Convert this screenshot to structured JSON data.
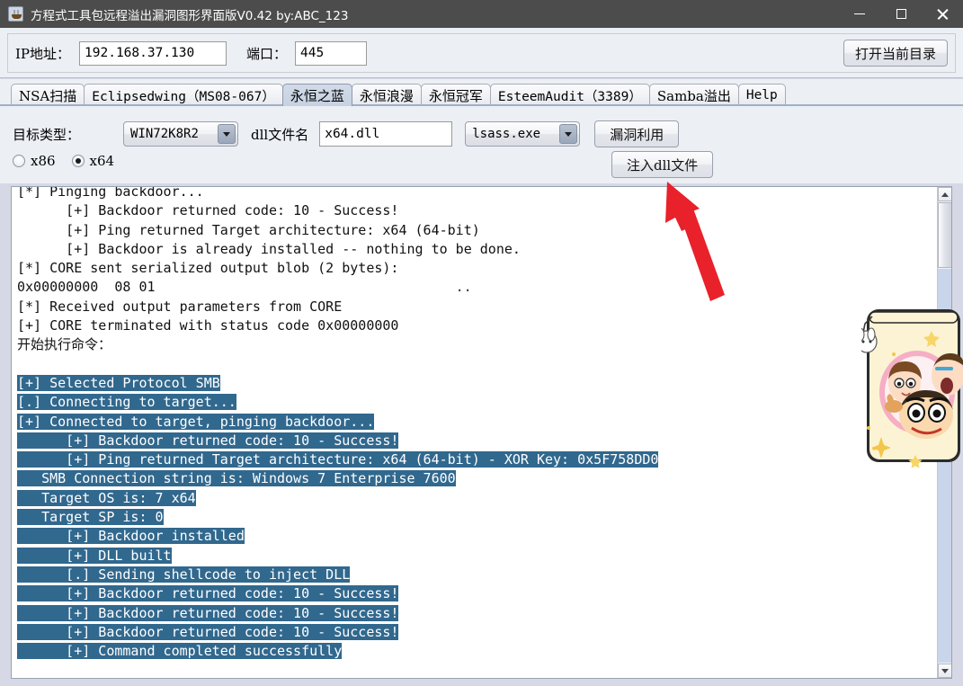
{
  "window": {
    "title": "方程式工具包远程溢出漏洞图形界面版V0.42 by:ABC_123",
    "app_icon": "java-coffee-cup-icon",
    "minimize_label": "最小化",
    "maximize_label": "最大化",
    "close_label": "关闭"
  },
  "toolbar": {
    "ip_label": "IP地址：",
    "ip_value": "192.168.37.130",
    "ip_placeholder": "",
    "port_label": "端口：",
    "port_value": "445",
    "port_placeholder": "",
    "open_dir_label": "打开当前目录"
  },
  "tabs": [
    {
      "label": "NSA扫描",
      "active": false,
      "cjk": true
    },
    {
      "label": "Eclipsedwing（MS08-067）",
      "active": false,
      "cjk": false
    },
    {
      "label": "永恒之蓝",
      "active": true,
      "cjk": true
    },
    {
      "label": "永恒浪漫",
      "active": false,
      "cjk": true
    },
    {
      "label": "永恒冠军",
      "active": false,
      "cjk": true
    },
    {
      "label": "EsteemAudit（3389）",
      "active": false,
      "cjk": false
    },
    {
      "label": "Samba溢出",
      "active": false,
      "cjk": true
    },
    {
      "label": "Help",
      "active": false,
      "cjk": false
    }
  ],
  "options": {
    "target_type_label": "目标类型：",
    "target_type_value": "WIN72K8R2",
    "dll_name_label": "dll文件名",
    "dll_name_value": "x64.dll",
    "dll_name_placeholder": "",
    "process_value": "lsass.exe",
    "exploit_button": "漏洞利用",
    "inject_button": "注入dll文件",
    "arch_x86_label": "x86",
    "arch_x64_label": "x64",
    "arch_selected": "x64"
  },
  "console": {
    "lines": [
      {
        "text": "[*] Pinging backdoor...",
        "selected": false,
        "cjk": false,
        "clipped_top": true
      },
      {
        "text": "      [+] Backdoor returned code: 10 - Success!",
        "selected": false,
        "cjk": false
      },
      {
        "text": "      [+] Ping returned Target architecture: x64 (64-bit)",
        "selected": false,
        "cjk": false
      },
      {
        "text": "      [+] Backdoor is already installed -- nothing to be done.",
        "selected": false,
        "cjk": false
      },
      {
        "text": "[*] CORE sent serialized output blob (2 bytes):",
        "selected": false,
        "cjk": false
      },
      {
        "text": "0x00000000  08 01",
        "selected": false,
        "cjk": false,
        "hex_ascii": ".."
      },
      {
        "text": "[*] Received output parameters from CORE",
        "selected": false,
        "cjk": false
      },
      {
        "text": "[+] CORE terminated with status code 0x00000000",
        "selected": false,
        "cjk": false
      },
      {
        "text": "开始执行命令：",
        "selected": false,
        "cjk": true
      },
      {
        "text": "",
        "selected": false,
        "cjk": false
      },
      {
        "text": "[+] Selected Protocol SMB",
        "selected": true,
        "cjk": false
      },
      {
        "text": "[.] Connecting to target...",
        "selected": true,
        "cjk": false
      },
      {
        "text": "[+] Connected to target, pinging backdoor...",
        "selected": true,
        "cjk": false
      },
      {
        "text": "      [+] Backdoor returned code: 10 - Success!",
        "selected": true,
        "cjk": false
      },
      {
        "text": "      [+] Ping returned Target architecture: x64 (64-bit) - XOR Key: 0x5F758DD0",
        "selected": true,
        "cjk": false
      },
      {
        "text": "   SMB Connection string is: Windows 7 Enterprise 7600",
        "selected": true,
        "cjk": false
      },
      {
        "text": "   Target OS is: 7 x64",
        "selected": true,
        "cjk": false
      },
      {
        "text": "   Target SP is: 0",
        "selected": true,
        "cjk": false
      },
      {
        "text": "      [+] Backdoor installed",
        "selected": true,
        "cjk": false
      },
      {
        "text": "      [+] DLL built",
        "selected": true,
        "cjk": false
      },
      {
        "text": "      [.] Sending shellcode to inject DLL",
        "selected": true,
        "cjk": false
      },
      {
        "text": "      [+] Backdoor returned code: 10 - Success!",
        "selected": true,
        "cjk": false
      },
      {
        "text": "      [+] Backdoor returned code: 10 - Success!",
        "selected": true,
        "cjk": false
      },
      {
        "text": "      [+] Backdoor returned code: 10 - Success!",
        "selected": true,
        "cjk": false
      },
      {
        "text": "      [+] Command completed successfully",
        "selected": true,
        "cjk": false
      }
    ],
    "selection_color": "#31688e",
    "selection_text_color": "#ffffff",
    "scroll_up_label": "向上滚动",
    "scroll_down_label": "向下滚动"
  },
  "annotation": {
    "arrow_color": "#e8212b",
    "arrow_points_to": "注入dll文件"
  },
  "decoration": {
    "sticker_description": "卡通贴图"
  },
  "colors": {
    "titlebar_bg": "#4c4c4c",
    "panel_bg": "#eceff4",
    "window_bg": "#d6d9e5",
    "active_tab_bg": "#c9d5e4",
    "console_bg": "#ffffff",
    "accent": "#31688e"
  }
}
